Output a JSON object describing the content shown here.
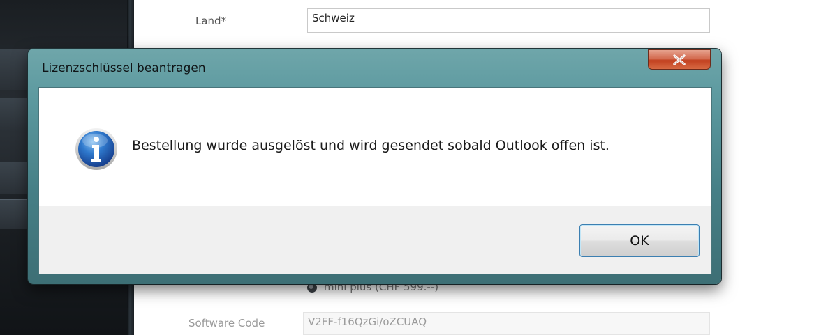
{
  "background": {
    "land_label": "Land*",
    "land_value": "Schweiz",
    "radio_option": "mini plus (CHF 599.--)",
    "software_code_label": "Software Code",
    "software_code_value": "V2FF-f16QzGi/oZCUAQ"
  },
  "dialog": {
    "title": "Lizenzschlüssel beantragen",
    "message": "Bestellung wurde ausgelöst und wird gesendet sobald Outlook offen ist.",
    "ok_label": "OK",
    "icon": "info-icon",
    "close_icon": "close-icon"
  },
  "colors": {
    "frame": "#5d9aa0",
    "close_button": "#c2401f",
    "ok_border": "#3c7fb1"
  }
}
